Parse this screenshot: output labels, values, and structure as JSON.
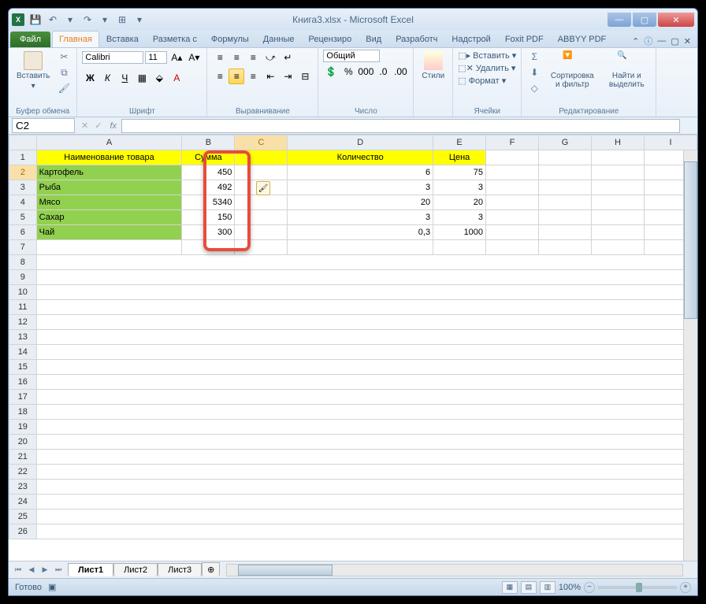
{
  "window": {
    "title": "Книга3.xlsx - Microsoft Excel"
  },
  "qat": {
    "save": "💾",
    "undo": "↶",
    "redo": "↷",
    "more": "▾"
  },
  "ribbon": {
    "file": "Файл",
    "tabs": [
      "Главная",
      "Вставка",
      "Разметка с",
      "Формулы",
      "Данные",
      "Рецензиро",
      "Вид",
      "Разработч",
      "Надстрой",
      "Foxit PDF",
      "ABBYY PDF"
    ],
    "active": 0,
    "groups": {
      "clipboard": {
        "label": "Буфер обмена",
        "paste": "Вставить"
      },
      "font": {
        "label": "Шрифт",
        "name": "Calibri",
        "size": "11"
      },
      "alignment": {
        "label": "Выравнивание"
      },
      "number": {
        "label": "Число",
        "format": "Общий"
      },
      "styles": {
        "label": "Стили",
        "btn": "Стили"
      },
      "cells": {
        "label": "Ячейки",
        "insert": "Вставить",
        "delete": "Удалить",
        "format": "Формат"
      },
      "editing": {
        "label": "Редактирование",
        "sort": "Сортировка и фильтр",
        "find": "Найти и выделить"
      }
    }
  },
  "namebox": "C2",
  "formula": "",
  "columns": [
    "A",
    "B",
    "C",
    "D",
    "E",
    "F",
    "G",
    "H",
    "I"
  ],
  "rows": [
    1,
    2,
    3,
    4,
    5,
    6,
    7,
    8,
    9,
    10,
    11,
    12,
    13,
    14,
    15,
    16,
    17,
    18,
    19,
    20,
    21,
    22,
    23,
    24,
    25,
    26
  ],
  "headers": {
    "A": "Наименование товара",
    "B": "Сумма",
    "D": "Количество",
    "E": "Цена"
  },
  "data": [
    {
      "A": "Картофель",
      "B": "450",
      "D": "6",
      "E": "75"
    },
    {
      "A": "Рыба",
      "B": "492",
      "D": "3",
      "E": "3"
    },
    {
      "A": "Мясо",
      "B": "5340",
      "D": "20",
      "E": "20"
    },
    {
      "A": "Сахар",
      "B": "150",
      "D": "3",
      "E": "3"
    },
    {
      "A": "Чай",
      "B": "300",
      "D": "0,3",
      "E": "1000"
    }
  ],
  "sheets": [
    "Лист1",
    "Лист2",
    "Лист3"
  ],
  "activeSheet": 0,
  "status": {
    "ready": "Готово",
    "zoom": "100%"
  }
}
